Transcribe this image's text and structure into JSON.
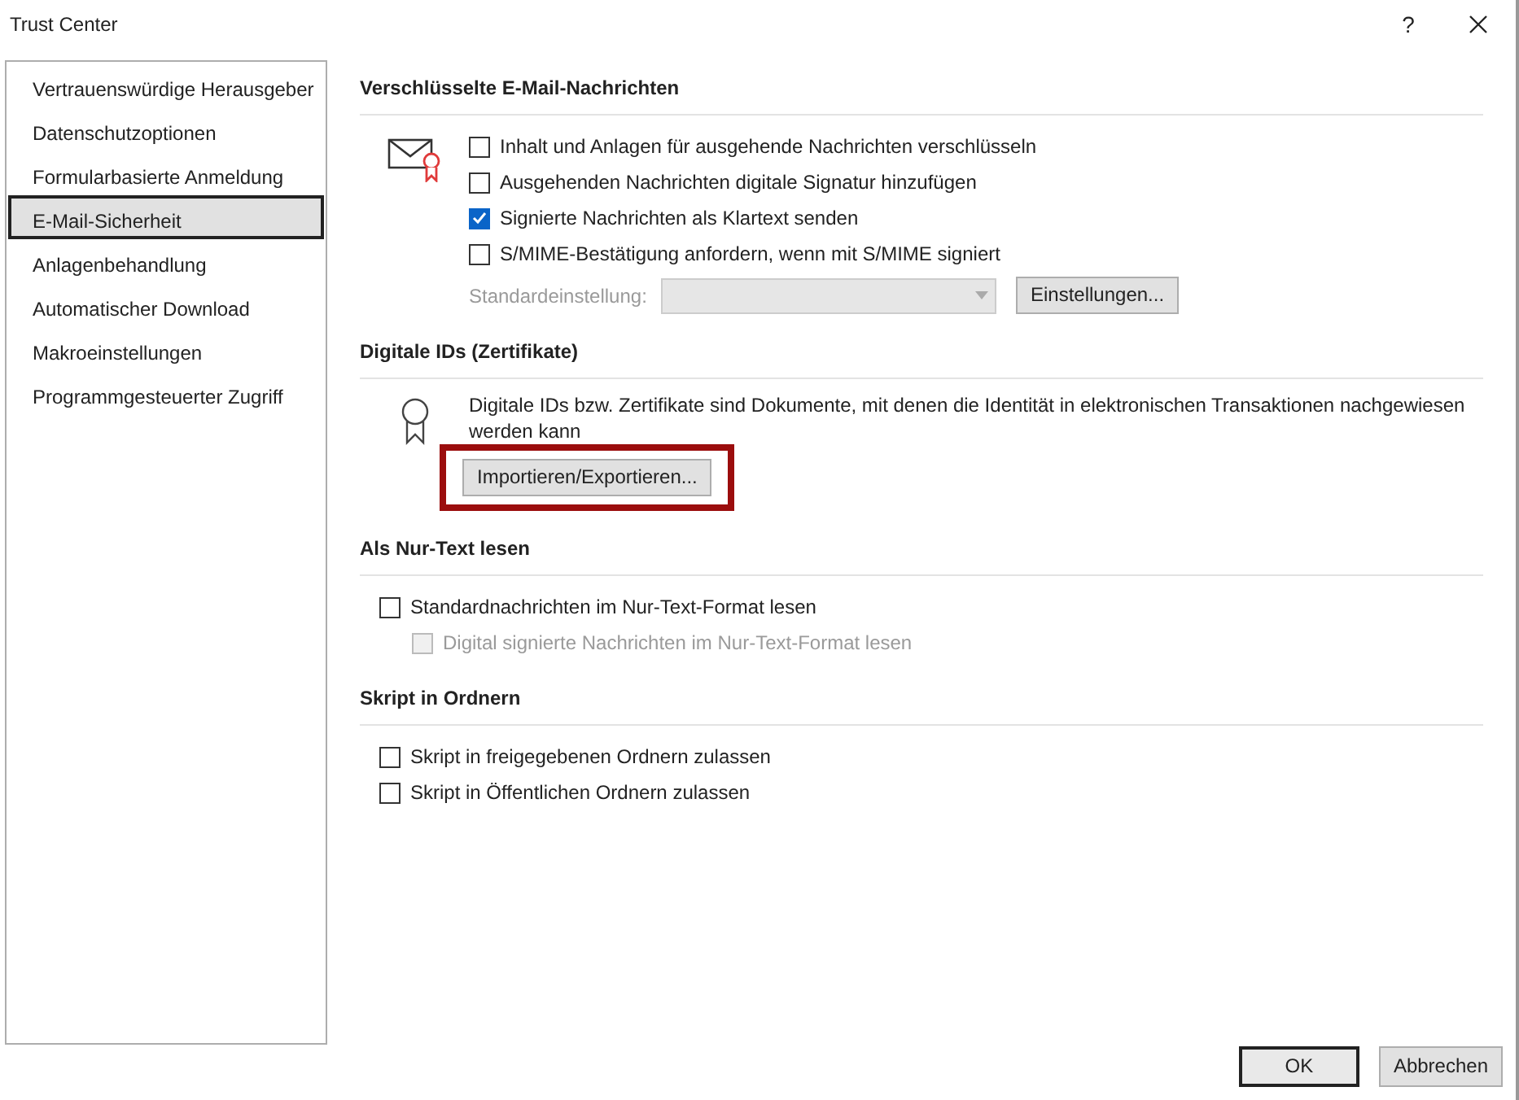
{
  "window": {
    "title": "Trust Center",
    "help": "?"
  },
  "sidebar": {
    "items": [
      {
        "label": "Vertrauenswürdige Herausgeber",
        "selected": false
      },
      {
        "label": "Datenschutzoptionen",
        "selected": false
      },
      {
        "label": "Formularbasierte Anmeldung",
        "selected": false
      },
      {
        "label": "E-Mail-Sicherheit",
        "selected": true
      },
      {
        "label": "Anlagenbehandlung",
        "selected": false
      },
      {
        "label": "Automatischer Download",
        "selected": false
      },
      {
        "label": "Makroeinstellungen",
        "selected": false
      },
      {
        "label": "Programmgesteuerter Zugriff",
        "selected": false
      }
    ]
  },
  "sections": [
    {
      "kind": "encryption",
      "heading": "Verschlüsselte E-Mail-Nachrichten",
      "options": [
        {
          "label": "Inhalt und Anlagen für ausgehende Nachrichten verschlüsseln",
          "checked": false,
          "disabled": false
        },
        {
          "label": "Ausgehenden Nachrichten digitale Signatur hinzufügen",
          "checked": false,
          "disabled": false
        },
        {
          "label": "Signierte Nachrichten als Klartext senden",
          "checked": true,
          "disabled": false
        },
        {
          "label": "S/MIME-Bestätigung anfordern, wenn mit S/MIME signiert",
          "checked": false,
          "disabled": false
        }
      ],
      "default_setting": {
        "label": "Standardeinstellung:",
        "disabled": true
      },
      "button": "Einstellungen..."
    },
    {
      "kind": "ids",
      "heading": "Digitale IDs (Zertifikate)",
      "text": "Digitale IDs bzw. Zertifikate sind Dokumente, mit denen die Identität in elektronischen Transaktionen nachgewiesen werden kann",
      "button": "Importieren/Exportieren...",
      "highlighted": true
    },
    {
      "kind": "checkboxes",
      "heading": "Als Nur-Text lesen",
      "options": [
        {
          "label": "Standardnachrichten im Nur-Text-Format lesen",
          "checked": false,
          "disabled": false,
          "children": [
            {
              "label": "Digital signierte Nachrichten im Nur-Text-Format lesen",
              "checked": false,
              "disabled": true
            }
          ]
        }
      ]
    },
    {
      "kind": "checkboxes",
      "heading": "Skript in Ordnern",
      "options": [
        {
          "label": "Skript in freigegebenen Ordnern zulassen",
          "checked": false,
          "disabled": false
        },
        {
          "label": "Skript in Öffentlichen Ordnern zulassen",
          "checked": false,
          "disabled": false
        }
      ]
    }
  ],
  "footer": {
    "buttons": [
      {
        "label": "OK",
        "default": true
      },
      {
        "label": "Abbrechen",
        "default": false
      }
    ]
  }
}
